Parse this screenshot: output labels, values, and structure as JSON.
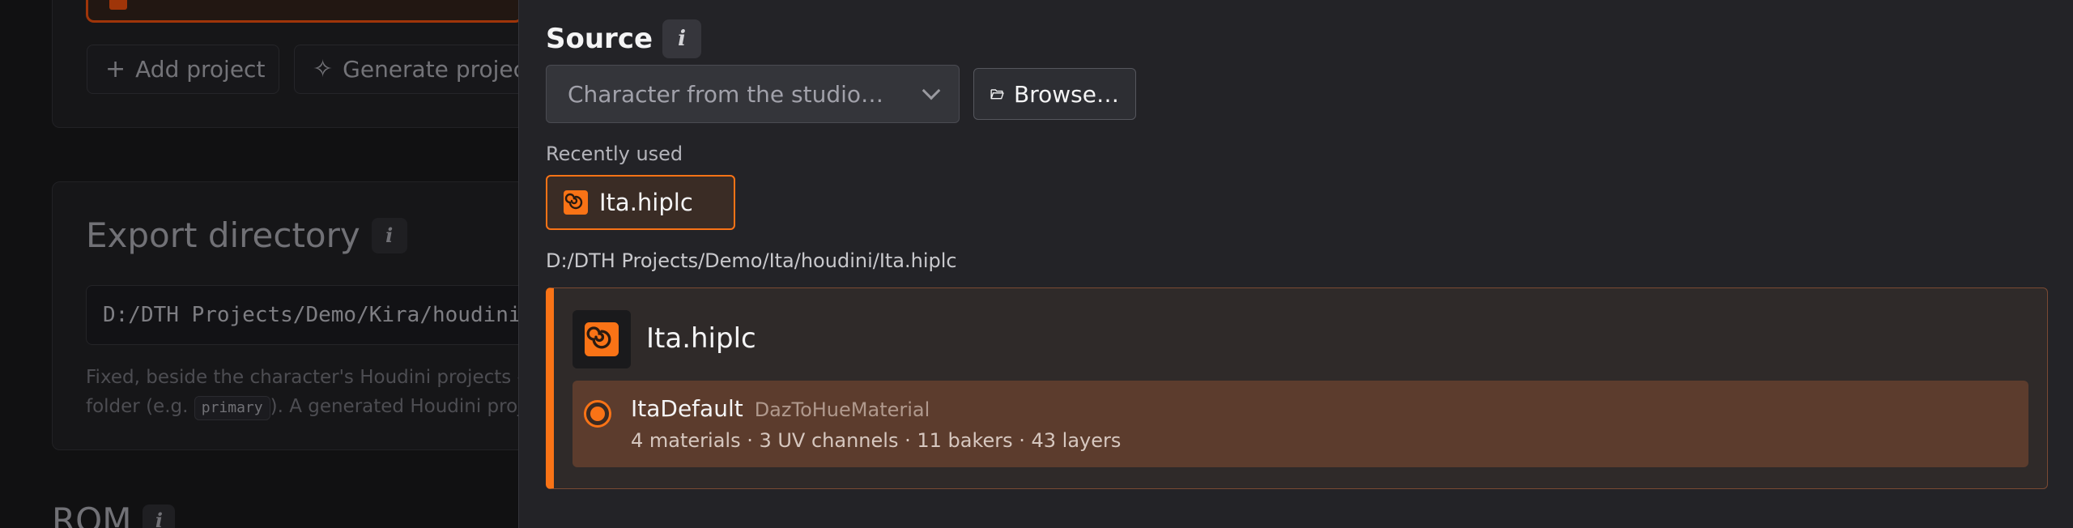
{
  "background": {
    "projects_card": {
      "add_project_label": "Add project",
      "generate_project_label": "Generate project"
    },
    "export_card": {
      "title": "Export directory",
      "path_value": "D:/DTH Projects/Demo/Kira/houdini",
      "helper_line1": "Fixed, beside the character's Houdini projects — t",
      "helper_line2_prefix": "folder (e.g. ",
      "helper_code": "primary",
      "helper_line2_suffix": "). A generated Houdini proje"
    },
    "rom_title": "ROM"
  },
  "panel": {
    "source_label": "Source",
    "select": {
      "value": "Character from the studio…"
    },
    "browse_label": "Browse…",
    "recent_label": "Recently used",
    "recent_items": [
      {
        "label": "Ita.hiplc"
      }
    ],
    "file_path": "D:/DTH Projects/Demo/Ita/houdini/Ita.hiplc",
    "file_card": {
      "name": "Ita.hiplc",
      "option": {
        "name": "ItaDefault",
        "type": "DazToHueMaterial",
        "meta": "4 materials · 3 UV channels · 11 bakers · 43 layers",
        "selected": true
      }
    }
  },
  "colors": {
    "accent": "#f97316",
    "panel_bg": "#232327",
    "selected_row": "#5c3c2d"
  }
}
